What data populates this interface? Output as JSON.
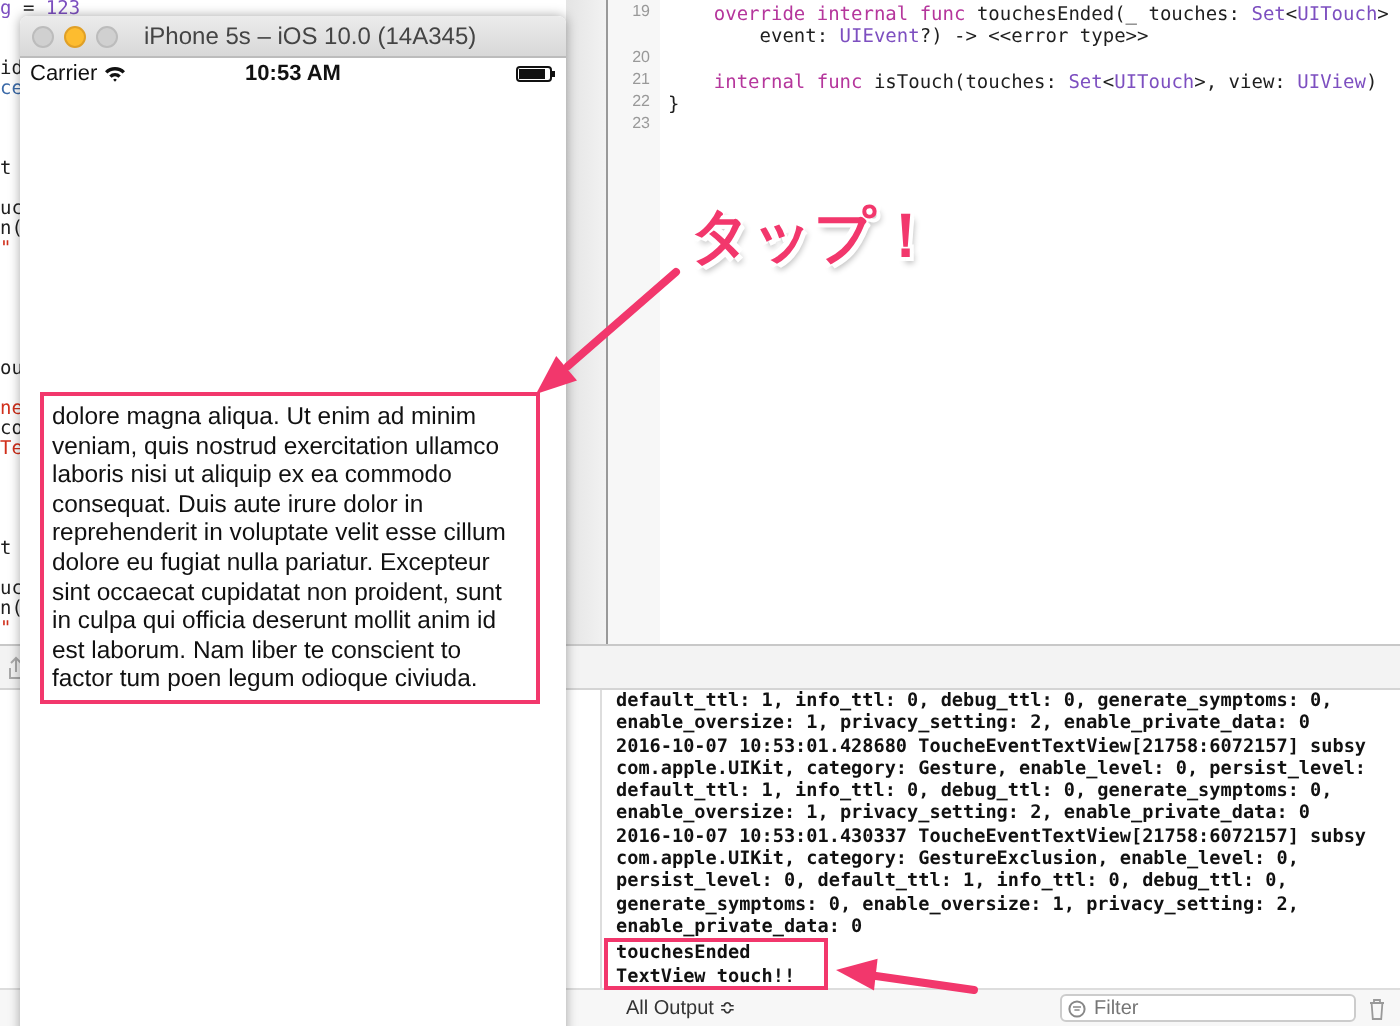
{
  "left_editor": {
    "rows": [
      {
        "kind": "code",
        "segments": [
          {
            "text": "g",
            "kind": "type"
          },
          {
            "text": " = ",
            "kind": "plain"
          },
          {
            "text": "123",
            "kind": "type"
          }
        ]
      },
      {
        "kind": "blank"
      },
      {
        "kind": "blank"
      },
      {
        "kind": "code",
        "segments": [
          {
            "text": "id",
            "kind": "plain"
          }
        ]
      },
      {
        "kind": "code",
        "segments": [
          {
            "text": "ce",
            "kind": "call"
          }
        ]
      },
      {
        "kind": "blank"
      },
      {
        "kind": "blank"
      },
      {
        "kind": "blank"
      },
      {
        "kind": "code",
        "segments": [
          {
            "text": "t",
            "kind": "plain"
          }
        ]
      },
      {
        "kind": "blank"
      },
      {
        "kind": "code",
        "segments": [
          {
            "text": "uc",
            "kind": "plain"
          }
        ]
      },
      {
        "kind": "code",
        "segments": [
          {
            "text": "n(",
            "kind": "plain"
          }
        ]
      },
      {
        "kind": "code",
        "segments": [
          {
            "text": "\"",
            "kind": "string"
          }
        ]
      },
      {
        "kind": "blank"
      },
      {
        "kind": "blank"
      },
      {
        "kind": "blank"
      },
      {
        "kind": "blank"
      },
      {
        "kind": "blank"
      },
      {
        "kind": "code",
        "segments": [
          {
            "text": "ou",
            "kind": "plain"
          }
        ]
      },
      {
        "kind": "blank"
      },
      {
        "kind": "code",
        "segments": [
          {
            "text": "ne",
            "kind": "string"
          }
        ]
      },
      {
        "kind": "code",
        "segments": [
          {
            "text": "co",
            "kind": "plain"
          }
        ]
      },
      {
        "kind": "code",
        "segments": [
          {
            "text": "Te",
            "kind": "string"
          }
        ]
      },
      {
        "kind": "blank"
      },
      {
        "kind": "blank"
      },
      {
        "kind": "blank"
      },
      {
        "kind": "blank"
      },
      {
        "kind": "code",
        "segments": [
          {
            "text": "t",
            "kind": "plain"
          }
        ]
      },
      {
        "kind": "blank"
      },
      {
        "kind": "code",
        "segments": [
          {
            "text": "uc",
            "kind": "plain"
          }
        ]
      },
      {
        "kind": "code",
        "segments": [
          {
            "text": "n(",
            "kind": "plain"
          }
        ]
      },
      {
        "kind": "code",
        "segments": [
          {
            "text": "\"",
            "kind": "string"
          }
        ]
      }
    ]
  },
  "editor": {
    "lines": [
      {
        "number": "19",
        "segments": [
          {
            "text": "    override internal func",
            "kind": "keyword"
          },
          {
            "text": " touchesEnded(_ touches: ",
            "kind": "plain"
          },
          {
            "text": "Set",
            "kind": "type"
          },
          {
            "text": "<",
            "kind": "plain"
          },
          {
            "text": "UITouch",
            "kind": "type"
          },
          {
            "text": ">",
            "kind": "plain"
          }
        ]
      },
      {
        "segments": [
          {
            "text": "        event: ",
            "kind": "plain"
          },
          {
            "text": "UIEvent",
            "kind": "type"
          },
          {
            "text": "?) -> <<error type>>",
            "kind": "plain"
          }
        ]
      },
      {
        "number": "20"
      },
      {
        "number": "21",
        "segments": [
          {
            "text": "    internal func",
            "kind": "keyword"
          },
          {
            "text": " isTouch(touches: ",
            "kind": "plain"
          },
          {
            "text": "Set",
            "kind": "type"
          },
          {
            "text": "<",
            "kind": "plain"
          },
          {
            "text": "UITouch",
            "kind": "type"
          },
          {
            "text": ">, view: ",
            "kind": "plain"
          },
          {
            "text": "UIView",
            "kind": "type"
          },
          {
            "text": ")",
            "kind": "plain"
          }
        ]
      },
      {
        "number": "22",
        "segments": [
          {
            "text": "}",
            "kind": "plain"
          }
        ]
      },
      {
        "number": "23"
      }
    ]
  },
  "simulator": {
    "title": "iPhone 5s – iOS 10.0 (14A345)",
    "carrier": "Carrier",
    "time": "10:53 AM",
    "text_view": "dolore magna aliqua. Ut enim ad minim veniam, quis nostrud exercitation ullamco laboris nisi ut aliquip ex ea commodo consequat. Duis aute irure dolor in reprehenderit in voluptate velit esse cillum dolore eu fugiat nulla pariatur. Excepteur sint occaecat cupidatat non proident, sunt in culpa qui officia deserunt mollit anim id est laborum. Nam liber te conscient to factor tum poen legum odioque civiuda."
  },
  "annotation": {
    "callout": "タップ！"
  },
  "console": {
    "lines": [
      "default_ttl: 1, info_ttl: 0, debug_ttl: 0, generate_symptoms: 0,",
      "enable_oversize: 1, privacy_setting: 2, enable_private_data: 0",
      "2016-10-07 10:53:01.428680 ToucheEventTextView[21758:6072157] subsy",
      "com.apple.UIKit, category: Gesture, enable_level: 0, persist_level:",
      "default_ttl: 1, info_ttl: 0, debug_ttl: 0, generate_symptoms: 0,",
      "enable_oversize: 1, privacy_setting: 2, enable_private_data: 0",
      "2016-10-07 10:53:01.430337 ToucheEventTextView[21758:6072157] subsy",
      "com.apple.UIKit, category: GestureExclusion, enable_level: 0,",
      "persist_level: 0, default_ttl: 1, info_ttl: 0, debug_ttl: 0,",
      "generate_symptoms: 0, enable_oversize: 1, privacy_setting: 2,",
      "enable_private_data: 0",
      "touchesEnded",
      "TextView touch!!"
    ]
  },
  "console_toolbar": {
    "output_menu": "All Output ≎",
    "filter": {
      "placeholder": "Filter"
    }
  }
}
